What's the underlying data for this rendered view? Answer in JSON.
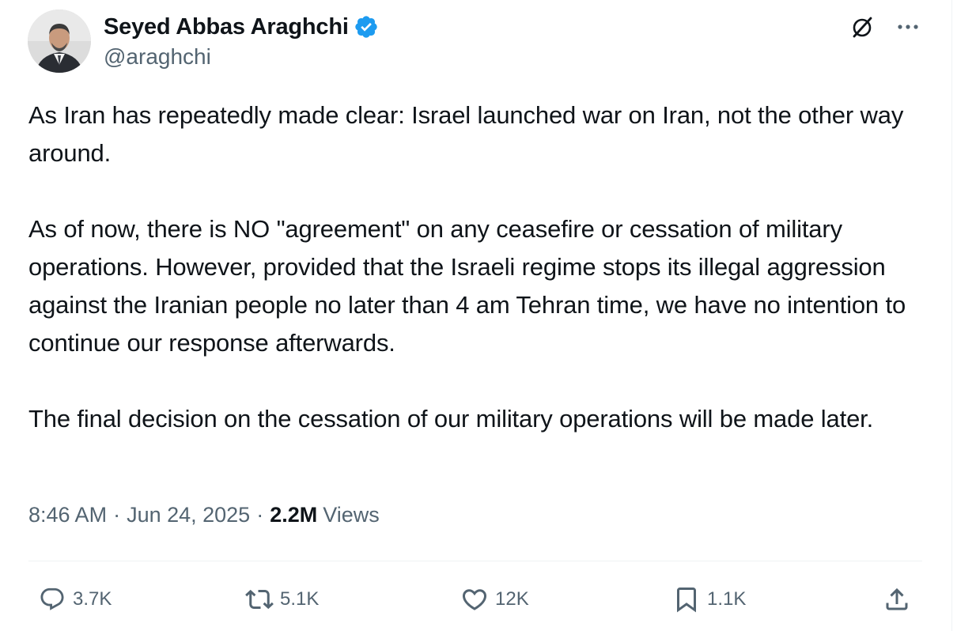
{
  "author": {
    "display_name": "Seyed Abbas Araghchi",
    "handle": "@araghchi",
    "verified": true,
    "verified_color": "#1d9bf0"
  },
  "header_icons": {
    "grok": "grok-icon",
    "more": "more-options-icon"
  },
  "tweet": {
    "paragraphs": [
      "As Iran has repeatedly made clear: Israel launched war on Iran, not the other way around.",
      "As of now, there is NO \"agreement\" on any ceasefire or cessation of military operations. However, provided that the Israeli regime stops its illegal aggression against the Iranian people no later than 4 am Tehran time, we have no intention to continue our response afterwards.",
      "The final decision on the cessation of our military operations will be made later."
    ]
  },
  "meta": {
    "time": "8:46 AM",
    "separator": "·",
    "date": "Jun 24, 2025",
    "views_count": "2.2M",
    "views_label": "Views"
  },
  "actions": {
    "replies": "3.7K",
    "reposts": "5.1K",
    "likes": "12K",
    "bookmarks": "1.1K"
  },
  "colors": {
    "text_primary": "#0f1419",
    "text_secondary": "#536471",
    "divider": "#eff3f4"
  }
}
